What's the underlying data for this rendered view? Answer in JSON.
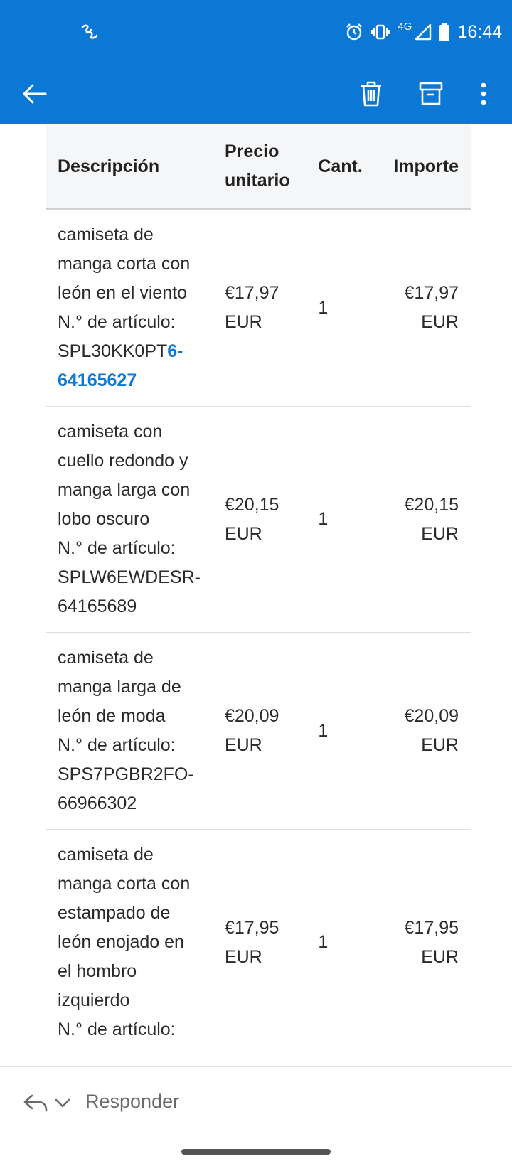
{
  "status_bar": {
    "time": "16:44",
    "network": "4G",
    "icons": [
      "signal-app-icon",
      "alarm-icon",
      "vibrate-icon",
      "cell-signal-icon",
      "battery-icon"
    ]
  },
  "toolbar": {
    "icons": [
      "back-arrow-icon",
      "trash-icon",
      "archive-icon",
      "more-vert-icon"
    ],
    "accent_color": "#0a78d4"
  },
  "table": {
    "headers": {
      "description": "Descripción",
      "unit_price_line1": "Precio",
      "unit_price_line2": "unitario",
      "quantity": "Cant.",
      "amount": "Importe"
    },
    "rows": [
      {
        "name": "camiseta de manga corta con león en el viento",
        "item_label": "N.° de artículo:",
        "code_plain": "SPL30KK0PT",
        "code_link": "6-64165627",
        "price": "€17,97 EUR",
        "qty": "1",
        "amount": "€17,97 EUR"
      },
      {
        "name": "camiseta con cuello redondo y manga larga con lobo oscuro",
        "item_label": "N.° de artículo:",
        "code_plain": "SPLW6EWDESR-64165689",
        "code_link": "",
        "price": "€20,15 EUR",
        "qty": "1",
        "amount": "€20,15 EUR"
      },
      {
        "name": "camiseta de manga larga de león de moda",
        "item_label": "N.° de artículo:",
        "code_plain": "SPS7PGBR2FO-66966302",
        "code_link": "",
        "price": "€20,09 EUR",
        "qty": "1",
        "amount": "€20,09 EUR"
      },
      {
        "name": "camiseta de manga corta con estampado de león enojado en el hombro izquierdo",
        "item_label": "N.° de artículo:",
        "code_plain": "",
        "code_link": "",
        "price": "€17,95 EUR",
        "qty": "1",
        "amount": "€17,95 EUR"
      }
    ]
  },
  "reply_bar": {
    "label": "Responder",
    "icons": [
      "reply-icon",
      "chevron-down-icon"
    ]
  }
}
